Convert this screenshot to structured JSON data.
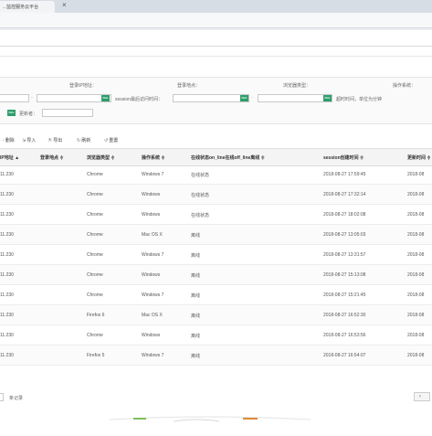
{
  "browser": {
    "tab_title": "...监控服务云平台",
    "close_glyph": "×"
  },
  "search": {
    "login_ip_label": "登录IP地址：",
    "login_place_label": "登录地点：",
    "browser_type_label": "浏览器类型：",
    "os_label": "操作系统：",
    "session_last_access_label": "session最后访问时间：",
    "timeout_label": "超时时间，单位为分钟",
    "updater_label": "更新者：",
    "cal_text": "BEE"
  },
  "toolbar": {
    "delete": "删除",
    "import": "导入",
    "export": "导出",
    "refresh": "刷新",
    "reset": "重置"
  },
  "table": {
    "columns": [
      "IP地址 ▲",
      "登录地点 ≑",
      "浏览器类型 ≑",
      "操作系统 ≑",
      "在线状态on_line在线off_line离线 ≑",
      "session创建时间 ≑",
      "更新时间 ≑"
    ],
    "rows": [
      [
        "11.230",
        "",
        "Chrome",
        "Windows 7",
        "在线状态",
        "2018-08-27 17:59:45",
        "2018-08"
      ],
      [
        "11.230",
        "",
        "Chrome",
        "Windows",
        "在线状态",
        "2018-08-27 17:32:14",
        "2018-08"
      ],
      [
        "11.230",
        "",
        "Chrome",
        "Windows",
        "在线状态",
        "2018-08-27 18:02:08",
        "2018-08"
      ],
      [
        "11.230",
        "",
        "Chrome",
        "Mac OS X",
        "离线",
        "2018-08-27 13:05:03",
        "2018-08"
      ],
      [
        "11.230",
        "",
        "Chrome",
        "Windows 7",
        "离线",
        "2018-08-27 13:31:57",
        "2018-08"
      ],
      [
        "11.230",
        "",
        "Chrome",
        "Windows",
        "离线",
        "2018-08-27 15:13:08",
        "2018-08"
      ],
      [
        "11.230",
        "",
        "Chrome",
        "Windows 7",
        "离线",
        "2018-08-27 15:21:45",
        "2018-08"
      ],
      [
        "11.230",
        "",
        "Firefox 6",
        "Mac OS X",
        "离线",
        "2018-08-27 16:52:30",
        "2018-08"
      ],
      [
        "11.230",
        "",
        "Chrome",
        "Windows",
        "离线",
        "2018-08-27 16:53:56",
        "2018-08"
      ],
      [
        "11.230",
        "",
        "Firefox 5",
        "Windows 7",
        "离线",
        "2018-08-27 16:54:07",
        "2018-08"
      ]
    ]
  },
  "footer": {
    "records_label": "条记录",
    "pager_prev": "‹"
  },
  "colors": {
    "calendar_green": "#2e9e6b",
    "footer_deco": "#7fbf5a"
  }
}
